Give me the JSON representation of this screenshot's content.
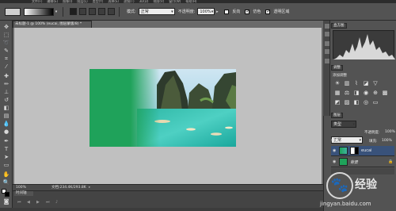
{
  "menubar": [
    "文件(F)",
    "编辑(E)",
    "图像(I)",
    "图层(L)",
    "类型(Y)",
    "选择(S)",
    "滤镜(T)",
    "3D(D)",
    "视图(V)",
    "窗口(W)",
    "帮助(H)"
  ],
  "optionsbar": {
    "mode_label": "模式:",
    "mode_value": "正常",
    "opacity_label": "不透明度:",
    "opacity_value": "100%",
    "reverse_label": "反向",
    "dither_label": "仿色",
    "transparency_label": "透明区域",
    "reverse_checked": false,
    "dither_checked": true,
    "transparency_checked": true
  },
  "document": {
    "tab_title": "未标题-1 @ 100% (eucai, 图层蒙版/8) *",
    "zoom": "100%",
    "doc_info": "文档:234.4K/293.8K",
    "canvas_color": "#c0c0c0",
    "image_green": "#1fa25a"
  },
  "timeline": {
    "tab": "时间轴"
  },
  "panels": {
    "histogram_tab": "直方图",
    "adjustments_tab": "调整",
    "adjustments_hint": "添加调整",
    "layers_tab": "图层",
    "kind_label": "类型",
    "blend_mode": "正常",
    "opacity_label": "不透明度:",
    "opacity_value": "100%",
    "lock_label": "锁定:",
    "fill_label": "填充:",
    "fill_value": "100%",
    "layers": [
      {
        "name": "eucai",
        "selected": true,
        "has_mask": true
      },
      {
        "name": "背景",
        "selected": false,
        "has_mask": false
      }
    ]
  },
  "watermark": {
    "logo_text": "经验",
    "url": "jingyan.baidu.com"
  }
}
